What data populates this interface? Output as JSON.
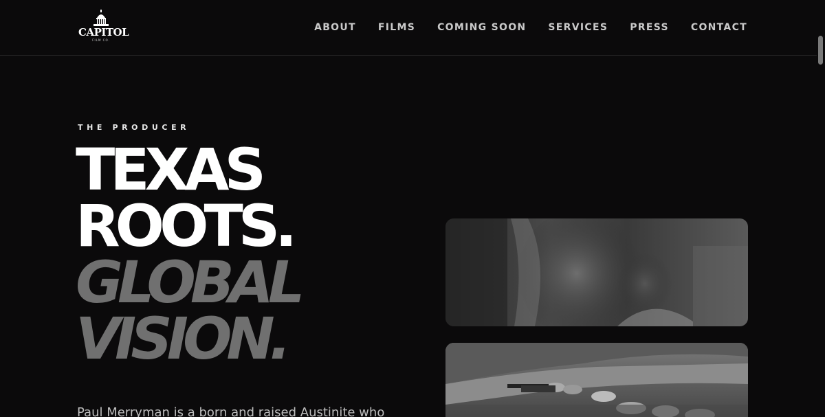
{
  "brand": {
    "name": "CAPITOL",
    "sub": "FILM CO."
  },
  "nav": {
    "items": [
      {
        "label": "ABOUT"
      },
      {
        "label": "FILMS"
      },
      {
        "label": "COMING SOON"
      },
      {
        "label": "SERVICES"
      },
      {
        "label": "PRESS"
      },
      {
        "label": "CONTACT"
      }
    ]
  },
  "hero": {
    "eyebrow": "THE PRODUCER",
    "line1": "TEXAS",
    "line2": "ROOTS.",
    "line3": "GLOBAL",
    "line4": "VISION.",
    "bio": "Paul Merryman is a born and raised Austinite who"
  },
  "colors": {
    "background": "#0b0a0b",
    "accent_grey": "#707070",
    "nav_text": "#c9c9c9"
  }
}
